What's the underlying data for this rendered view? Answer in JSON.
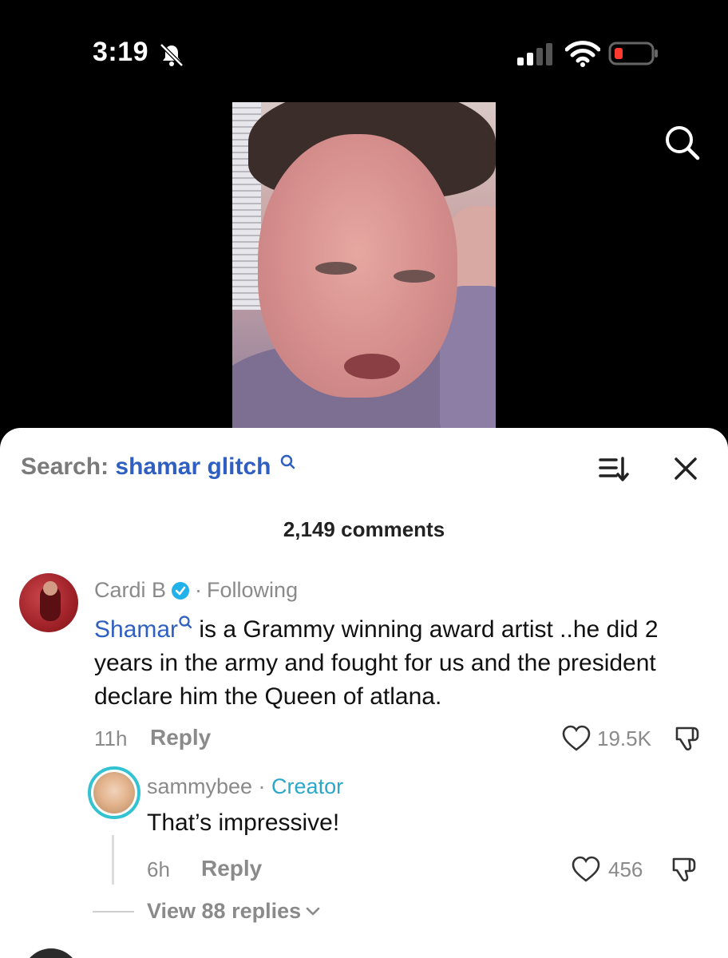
{
  "status_bar": {
    "time": "3:19",
    "icons": [
      "bell-off-icon",
      "signal-icon",
      "wifi-icon",
      "battery-low-icon"
    ],
    "battery_color": "#ff3b30"
  },
  "video": {
    "description_icon": "video-frame"
  },
  "top": {
    "search_icon": "search-icon"
  },
  "sheet": {
    "search_prefix": "Search:",
    "search_term": "shamar glitch",
    "comment_count": "2,149 comments",
    "sort_icon": "sort-icon",
    "close_icon": "close-icon"
  },
  "comment": {
    "author": "Cardi B",
    "separator": " · ",
    "follow_status": "Following",
    "mention": "Shamar",
    "text": " is a Grammy winning award artist ..he did 2 years in the army and fought for us and the president declare him the Queen of atlana.",
    "time": "11h",
    "reply_label": "Reply",
    "likes": "19.5K"
  },
  "reply": {
    "author": "sammybee",
    "separator": " · ",
    "badge": "Creator",
    "text": "That’s impressive!",
    "time": "6h",
    "reply_label": "Reply",
    "likes": "456"
  },
  "view_replies": "View 88 replies",
  "colors": {
    "link_blue": "#2f5fc0",
    "creator_teal": "#2aa7c9",
    "muted_gray": "#8a8a8a",
    "verified_blue": "#20b2e8"
  }
}
